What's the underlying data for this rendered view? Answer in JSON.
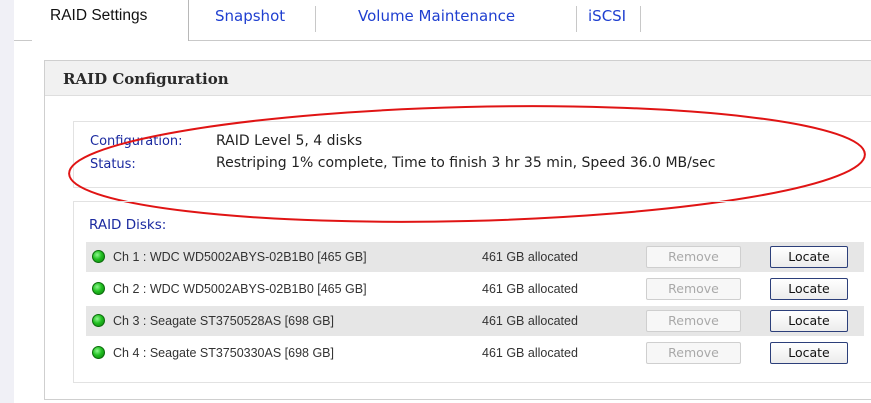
{
  "tabs": [
    {
      "label": "RAID Settings",
      "active": true
    },
    {
      "label": "Snapshot",
      "active": false
    },
    {
      "label": "Volume Maintenance",
      "active": false
    },
    {
      "label": "iSCSI",
      "active": false
    }
  ],
  "panel": {
    "title": "RAID Configuration",
    "configuration_label": "Configuration:",
    "configuration_value": "RAID Level 5, 4 disks",
    "status_label": "Status:",
    "status_value": "Restriping 1% complete, Time to finish 3 hr 35 min, Speed 36.0 MB/sec"
  },
  "disks": {
    "title": "RAID Disks:",
    "remove_label": "Remove",
    "locate_label": "Locate",
    "items": [
      {
        "name": "Ch 1 : WDC WD5002ABYS-02B1B0 [465 GB]",
        "allocated": "461 GB allocated",
        "status_color": "#22c022"
      },
      {
        "name": "Ch 2 : WDC WD5002ABYS-02B1B0 [465 GB]",
        "allocated": "461 GB allocated",
        "status_color": "#22c022"
      },
      {
        "name": "Ch 3 : Seagate ST3750528AS [698 GB]",
        "allocated": "461 GB allocated",
        "status_color": "#22c022"
      },
      {
        "name": "Ch 4 : Seagate ST3750330AS [698 GB]",
        "allocated": "461 GB allocated",
        "status_color": "#22c022"
      }
    ]
  },
  "colors": {
    "tab_inactive_text": "#1f3fd0",
    "label_text": "#1b2aa0",
    "annotation": "#e01414"
  }
}
